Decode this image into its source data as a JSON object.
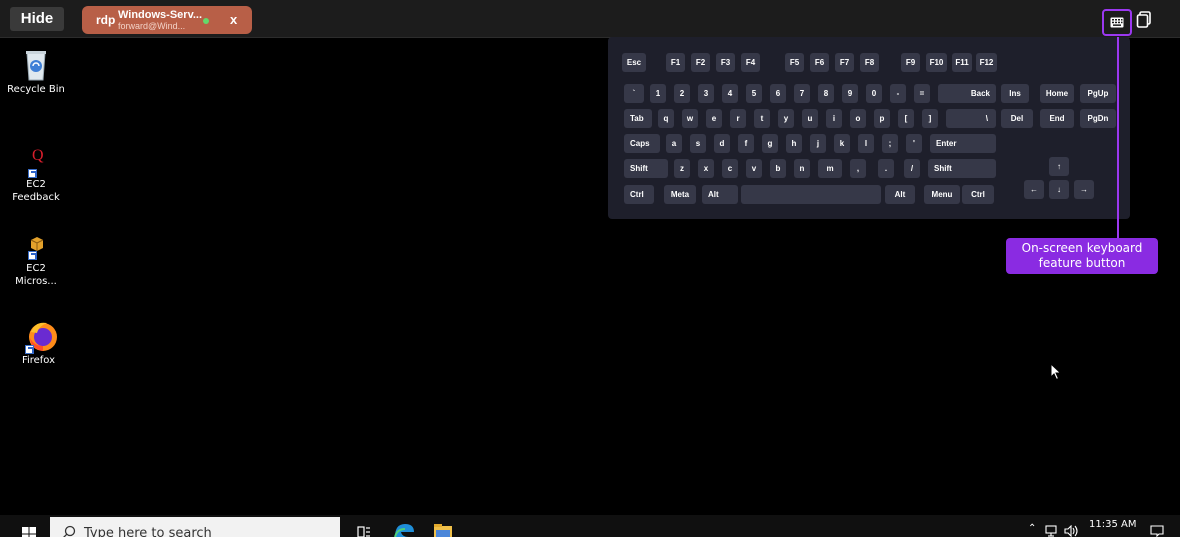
{
  "toolbar": {
    "hide_label": "Hide",
    "session": {
      "protocol": "rdp",
      "name": "Windows-Serv...",
      "user": "forward@Wind...",
      "status_color": "#63d96b",
      "close_label": "x"
    },
    "keyboard_button_icon": "keyboard-icon",
    "clipboard_button_icon": "clipboard-icon"
  },
  "desktop_icons": [
    {
      "label": "Recycle Bin",
      "icon": "recycle-bin-icon"
    },
    {
      "label": "EC2 Feedback",
      "icon": "feedback-icon"
    },
    {
      "label": "EC2\nMicros...",
      "icon": "package-icon"
    },
    {
      "label": "Firefox",
      "icon": "firefox-icon"
    }
  ],
  "keyboard": {
    "rows": [
      [
        "Esc",
        "F1",
        "F2",
        "F3",
        "F4",
        "F5",
        "F6",
        "F7",
        "F8",
        "F9",
        "F10",
        "F11",
        "F12"
      ],
      [
        "`",
        "1",
        "2",
        "3",
        "4",
        "5",
        "6",
        "7",
        "8",
        "9",
        "0",
        "-",
        "=",
        "Back",
        "Ins",
        "Home",
        "PgUp"
      ],
      [
        "Tab",
        "q",
        "w",
        "e",
        "r",
        "t",
        "y",
        "u",
        "i",
        "o",
        "p",
        "[",
        "]",
        "\\",
        "Del",
        "End",
        "PgDn"
      ],
      [
        "Caps",
        "a",
        "s",
        "d",
        "f",
        "g",
        "h",
        "j",
        "k",
        "l",
        ";",
        "'",
        "Enter"
      ],
      [
        "Shift",
        "z",
        "x",
        "c",
        "v",
        "b",
        "n",
        "m",
        ",",
        ".",
        "/",
        "Shift",
        "↑"
      ],
      [
        "Ctrl",
        "Meta",
        "Alt",
        "",
        "Alt",
        "Menu",
        "Ctrl",
        "←",
        "↓",
        "→"
      ]
    ]
  },
  "callout": {
    "line1": "On-screen keyboard",
    "line2": "feature button",
    "color": "#8a2be2"
  },
  "taskbar": {
    "search_placeholder": "Type here to search",
    "time": "11:35 AM"
  }
}
